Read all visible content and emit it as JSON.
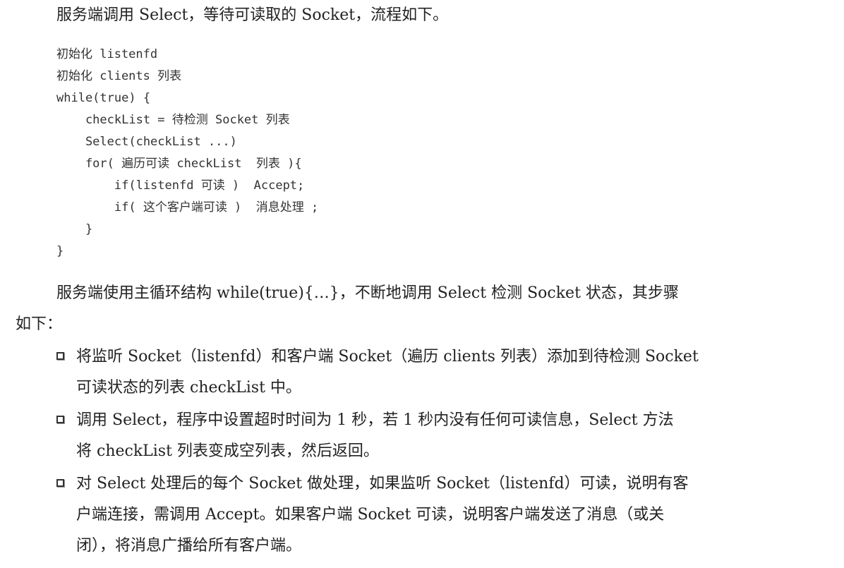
{
  "intro": "服务端调用 Select，等待可读取的 Socket，流程如下。",
  "code_lines": [
    "初始化 listenfd",
    "初始化 clients 列表",
    "while(true) {",
    "    checkList = 待检测 Socket 列表",
    "    Select(checkList ...)",
    "    for( 遍历可读 checkList  列表 ){",
    "        if(listenfd 可读 )  Accept;",
    "        if( 这个客户端可读 )  消息处理 ;",
    "    }",
    "}"
  ],
  "paragraph": {
    "line1": "服务端使用主循环结构 while(true){…}，不断地调用 Select 检测 Socket 状态，其步骤",
    "line2": "如下："
  },
  "bullets": [
    {
      "line1": "将监听 Socket（listenfd）和客户端 Socket（遍历 clients 列表）添加到待检测 Socket",
      "line2": "可读状态的列表 checkList 中。",
      "line3": ""
    },
    {
      "line1": "调用 Select，程序中设置超时时间为 1 秒，若 1 秒内没有任何可读信息，Select 方法",
      "line2": "将 checkList 列表变成空列表，然后返回。",
      "line3": ""
    },
    {
      "line1": "对 Select 处理后的每个 Socket 做处理，如果监听 Socket（listenfd）可读，说明有客",
      "line2": "户端连接，需调用 Accept。如果客户端 Socket 可读，说明客户端发送了消息（或关",
      "line3": "闭），将消息广播给所有客户端。"
    }
  ]
}
